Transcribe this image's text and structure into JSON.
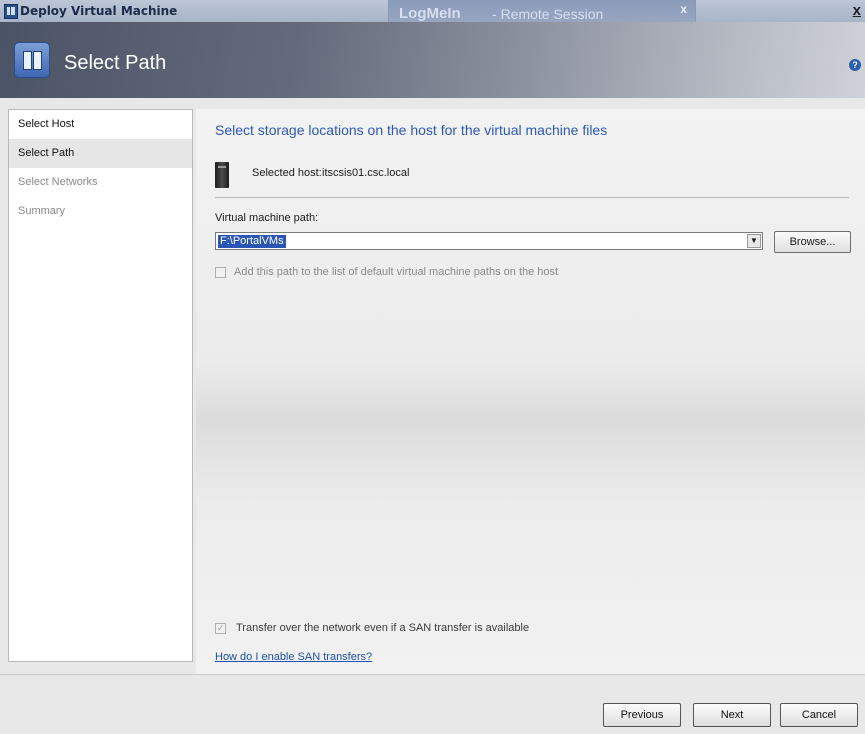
{
  "window": {
    "title": "Deploy Virtual Machine",
    "close_glyph": "x"
  },
  "remote_banner": {
    "brand": "LogMeIn",
    "separator": "-",
    "session": "Remote Session",
    "close_glyph": "x"
  },
  "header": {
    "title": "Select Path",
    "icon": "deploy-vm-icon",
    "help_glyph": "?"
  },
  "sidebar": {
    "items": [
      {
        "label": "Select Host",
        "state": "normal"
      },
      {
        "label": "Select Path",
        "state": "active"
      },
      {
        "label": "Select Networks",
        "state": "disabled"
      },
      {
        "label": "Summary",
        "state": "disabled"
      }
    ]
  },
  "main": {
    "heading": "Select storage locations on the host for the virtual machine files",
    "host_label": "Selected host:",
    "host_value": "itscsis01.csc.local",
    "path_label": "Virtual machine path:",
    "path_value": "F:\\PortalVMs",
    "browse_label": "Browse...",
    "default_path_checkbox": {
      "label": "Add this path to the list of default virtual machine paths on the host",
      "checked": false,
      "enabled": false
    },
    "transfer_checkbox": {
      "label": "Transfer over the network even if a SAN transfer is available",
      "checked": true,
      "enabled": false
    },
    "san_link": "How do I enable SAN transfers?"
  },
  "footer": {
    "previous": "Previous",
    "next": "Next",
    "cancel": "Cancel"
  },
  "colors": {
    "accent": "#2e58b6",
    "selection": "#2a55b7",
    "link": "#1f4fb0"
  }
}
